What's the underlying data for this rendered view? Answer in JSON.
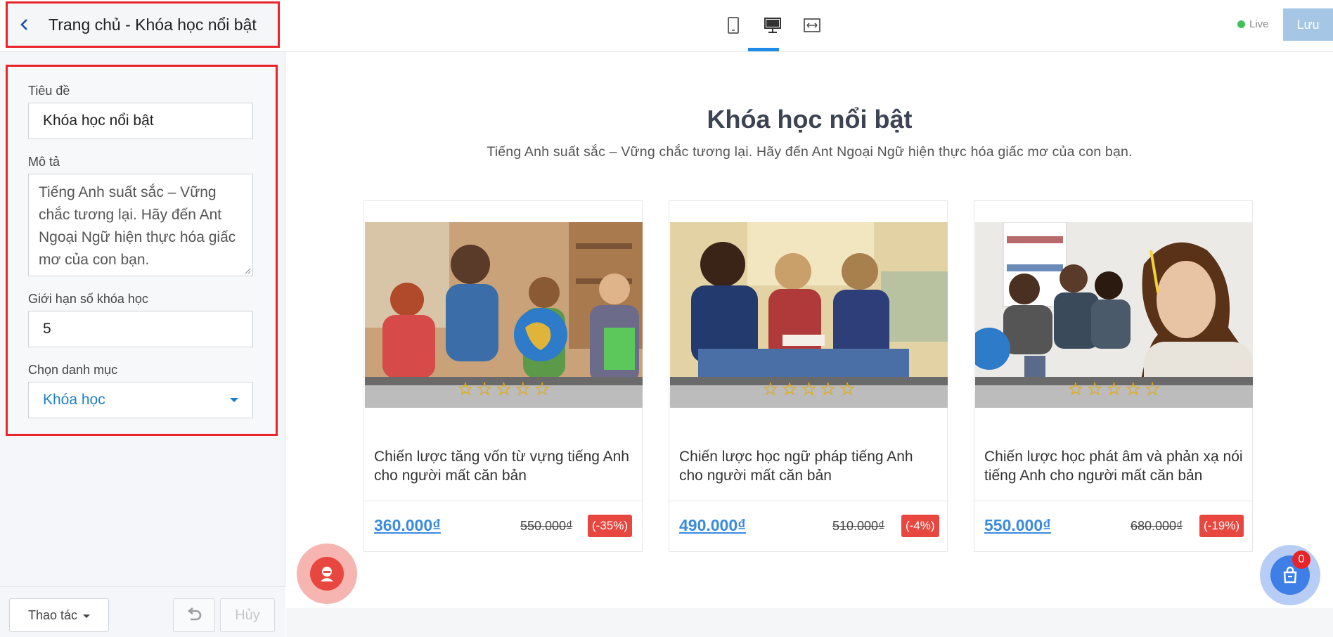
{
  "header": {
    "page_title": "Trang chủ - Khóa học nổi bật",
    "live_label": "Live",
    "save_label": "Lưu"
  },
  "sidebar": {
    "fields": {
      "title_label": "Tiêu đề",
      "title_value": "Khóa học nổi bật",
      "desc_label": "Mô tả",
      "desc_value": "Tiếng Anh suất sắc – Vững chắc tương lại. Hãy đến Ant Ngoại Ngữ hiện thực hóa giấc mơ của con bạn.",
      "limit_label": "Giới hạn số khóa học",
      "limit_value": "5",
      "category_label": "Chọn danh mục",
      "category_value": "Khóa học"
    },
    "footer": {
      "actions_label": "Thao tác",
      "cancel_label": "Hủy"
    }
  },
  "preview": {
    "section_title": "Khóa học nổi bật",
    "section_desc": "Tiếng Anh suất sắc – Vững chắc tương lại. Hãy đến Ant Ngoại Ngữ hiện thực hóa giấc mơ của con bạn.",
    "cards": [
      {
        "title": "Chiến lược tăng vốn từ vựng tiếng Anh cho người mất căn bản",
        "price": "360.000₫",
        "old_price": "550.000₫",
        "discount": "(-35%)",
        "rating": 0
      },
      {
        "title": "Chiến lược học ngữ pháp tiếng Anh cho người mất căn bản",
        "price": "490.000₫",
        "old_price": "510.000₫",
        "discount": "(-4%)",
        "rating": 0
      },
      {
        "title": "Chiến lược học phát âm và phản xạ nói tiếng Anh cho người mất căn bản",
        "price": "550.000₫",
        "old_price": "680.000₫",
        "discount": "(-19%)",
        "rating": 0
      }
    ],
    "cart_count": "0"
  },
  "colors": {
    "accent": "#1f8be7",
    "highlight_border": "#e8242a",
    "price": "#3a8ae0",
    "discount": "#e8473f",
    "live": "#3ec25a"
  },
  "icons": [
    "back-chevron-icon",
    "mobile-view-icon",
    "desktop-view-icon",
    "fullwidth-view-icon",
    "undo-icon",
    "support-agent-icon",
    "shopping-bag-icon",
    "star-icon"
  ]
}
